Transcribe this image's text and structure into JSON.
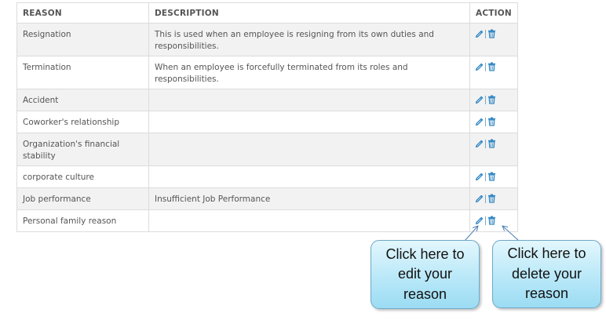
{
  "table": {
    "headers": {
      "reason": "REASON",
      "description": "DESCRIPTION",
      "action": "ACTION"
    },
    "rows": [
      {
        "reason": "Resignation",
        "description": "This is used when an employee is resigning from its own duties and responsibilities."
      },
      {
        "reason": "Termination",
        "description": "When an employee is forcefully terminated from its roles and responsibilities."
      },
      {
        "reason": "Accident",
        "description": ""
      },
      {
        "reason": "Coworker's relationship",
        "description": ""
      },
      {
        "reason": "Organization's financial stability",
        "description": ""
      },
      {
        "reason": "corporate culture",
        "description": ""
      },
      {
        "reason": "Job performance",
        "description": "Insufficient Job Performance"
      },
      {
        "reason": "Personal family reason",
        "description": ""
      }
    ],
    "action_icons": [
      "pencil-icon",
      "trash-icon"
    ]
  },
  "callouts": {
    "edit": "Click here to edit your reason",
    "delete": "Click here to delete your reason"
  },
  "colors": {
    "icon_blue": "#2f86c4",
    "row_stripe": "#f2f2f2",
    "callout_fill": "#b9e8f8"
  }
}
